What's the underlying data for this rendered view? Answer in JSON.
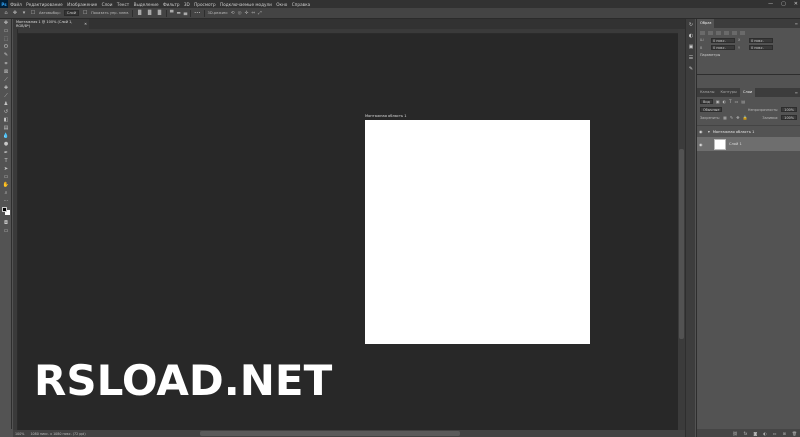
{
  "app": {
    "logo": "Ps"
  },
  "menu": [
    "Файл",
    "Редактирование",
    "Изображение",
    "Слои",
    "Текст",
    "Выделение",
    "Фильтр",
    "3D",
    "Просмотр",
    "Подключаемые модули",
    "Окно",
    "Справка"
  ],
  "window_controls": {
    "minimize": "—",
    "maximize": "▢",
    "close": "✕"
  },
  "options_bar": {
    "tool_icon": "move-tool-icon",
    "auto_select_label": "Автовыбор:",
    "auto_select_value": "Слой",
    "transform_label": "Показать упр. элем.",
    "more_label": "•••",
    "mode_3d_label": "3D-режим:"
  },
  "document": {
    "tab_title": "Монтажная 1 @ 100% (Слой 1, RGB/8*)",
    "artboard_label": "Монтажная область 1"
  },
  "status": {
    "zoom": "100%",
    "doc_info": "1080 пикс. x 1080 пикс. (72 ppi)"
  },
  "watermark": "RSLOAD.NET",
  "panels": {
    "top_tabs": [
      "Образ"
    ],
    "properties": {
      "w_label": "Ш",
      "h_label": "В",
      "x_label": "X",
      "y_label": "Y",
      "w_value": "0 пикс.",
      "h_value": "0 пикс.",
      "x_value": "0 пикс.",
      "y_value": "0 пикс.",
      "sub_label": "Параметры"
    },
    "layer_tabs": [
      "Каналы",
      "Контуры",
      "Слои"
    ],
    "active_layer_tab": "Слои",
    "kind_filter": "Вид",
    "blend_mode": "Обычные",
    "opacity_label": "Непрозрачность:",
    "opacity_value": "100%",
    "lock_label": "Закрепить:",
    "fill_label": "Заливка:",
    "fill_value": "100%",
    "layers": [
      {
        "name": "Монтажная область 1",
        "type": "group"
      },
      {
        "name": "Слой 1",
        "type": "layer"
      }
    ]
  }
}
